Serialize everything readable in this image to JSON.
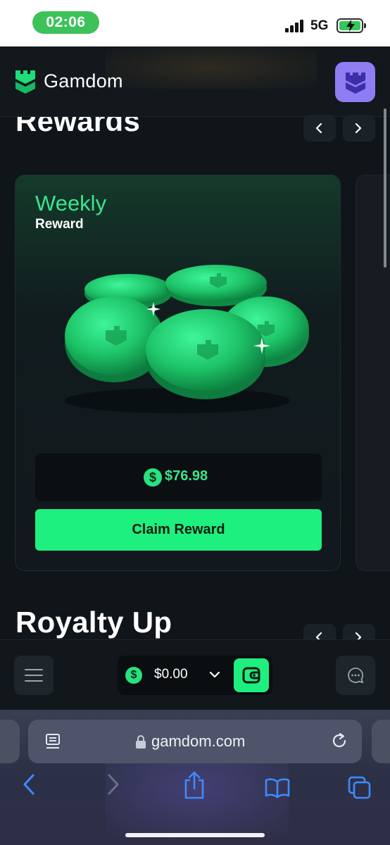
{
  "status_bar": {
    "time": "02:06",
    "network": "5G"
  },
  "header": {
    "brand": "Gamdom"
  },
  "rewards_section": {
    "title": "Rewards"
  },
  "reward_card": {
    "title": "Weekly",
    "subtitle": "Reward",
    "currency_symbol": "$",
    "amount": "$76.98",
    "claim_label": "Claim Reward"
  },
  "royalty_section": {
    "title": "Royalty Up"
  },
  "bottom_bar": {
    "currency_symbol": "$",
    "balance": "$0.00"
  },
  "browser": {
    "url": "gamdom.com"
  },
  "colors": {
    "accent_green": "#1df07e",
    "title_green": "#3ce48e",
    "avatar_purple": "#8e7df3",
    "background": "#101519"
  },
  "icons": [
    "menu-icon",
    "chevron-down-icon",
    "wallet-icon",
    "chat-icon",
    "chevron-left-icon",
    "chevron-right-icon",
    "reader-icon",
    "lock-icon",
    "reload-icon",
    "back-icon",
    "forward-icon",
    "share-icon",
    "bookmarks-icon",
    "tabs-icon"
  ]
}
